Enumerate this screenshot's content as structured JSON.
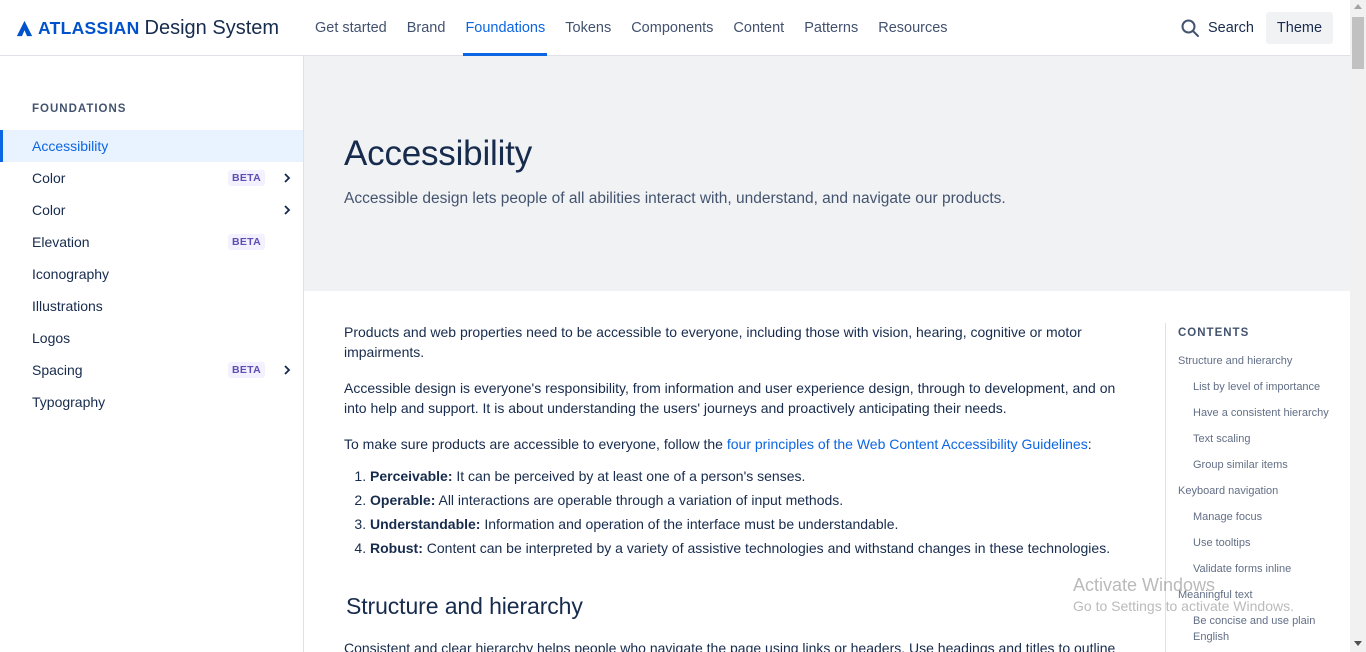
{
  "header": {
    "brand": "ATLASSIAN",
    "product": "Design System",
    "nav": [
      {
        "label": "Get started",
        "active": false
      },
      {
        "label": "Brand",
        "active": false
      },
      {
        "label": "Foundations",
        "active": true
      },
      {
        "label": "Tokens",
        "active": false
      },
      {
        "label": "Components",
        "active": false
      },
      {
        "label": "Content",
        "active": false
      },
      {
        "label": "Patterns",
        "active": false
      },
      {
        "label": "Resources",
        "active": false
      }
    ],
    "search_label": "Search",
    "theme_label": "Theme"
  },
  "sidebar": {
    "heading": "FOUNDATIONS",
    "items": [
      {
        "label": "Accessibility",
        "badge": "",
        "chevron": false,
        "active": true
      },
      {
        "label": "Color",
        "badge": "BETA",
        "chevron": true,
        "active": false
      },
      {
        "label": "Color",
        "badge": "",
        "chevron": true,
        "active": false
      },
      {
        "label": "Elevation",
        "badge": "BETA",
        "chevron": false,
        "active": false
      },
      {
        "label": "Iconography",
        "badge": "",
        "chevron": false,
        "active": false
      },
      {
        "label": "Illustrations",
        "badge": "",
        "chevron": false,
        "active": false
      },
      {
        "label": "Logos",
        "badge": "",
        "chevron": false,
        "active": false
      },
      {
        "label": "Spacing",
        "badge": "BETA",
        "chevron": true,
        "active": false
      },
      {
        "label": "Typography",
        "badge": "",
        "chevron": false,
        "active": false
      }
    ]
  },
  "hero": {
    "title": "Accessibility",
    "subtitle": "Accessible design lets people of all abilities interact with, understand, and navigate our products."
  },
  "content": {
    "p1": "Products and web properties need to be accessible to everyone, including those with vision, hearing, cognitive or motor impairments.",
    "p2": "Accessible design is everyone's responsibility, from information and user experience design, through to development, and on into help and support. It is about understanding the users' journeys and proactively anticipating their needs.",
    "p3_before": "To make sure products are accessible to everyone, follow the ",
    "p3_link": "four principles of the Web Content Accessibility Guidelines",
    "p3_after": ":",
    "principles": [
      {
        "term": "Perceivable:",
        "text": " It can be perceived by at least one of a person's senses."
      },
      {
        "term": "Operable:",
        "text": " All interactions are operable through a variation of input methods."
      },
      {
        "term": "Understandable:",
        "text": " Information and operation of the interface must be understandable."
      },
      {
        "term": "Robust:",
        "text": " Content can be interpreted by a variety of assistive technologies and withstand changes in these technologies."
      }
    ],
    "h2": "Structure and hierarchy",
    "p4": "Consistent and clear hierarchy helps people who navigate the page using links or headers. Use headings and titles to outline"
  },
  "toc": {
    "heading": "CONTENTS",
    "items": [
      {
        "label": "Structure and hierarchy",
        "level": 1
      },
      {
        "label": "List by level of importance",
        "level": 2
      },
      {
        "label": "Have a consistent hierarchy",
        "level": 2
      },
      {
        "label": "Text scaling",
        "level": 2
      },
      {
        "label": "Group similar items",
        "level": 2
      },
      {
        "label": "Keyboard navigation",
        "level": 1
      },
      {
        "label": "Manage focus",
        "level": 2
      },
      {
        "label": "Use tooltips",
        "level": 2
      },
      {
        "label": "Validate forms inline",
        "level": 2
      },
      {
        "label": "Meaningful text",
        "level": 1
      },
      {
        "label": "Be concise and use plain English",
        "level": 2
      }
    ]
  },
  "watermark": {
    "line1": "Activate Windows",
    "line2": "Go to Settings to activate Windows."
  },
  "colors": {
    "accent": "#0c66e4",
    "text": "#172b4d",
    "subtle": "#44546f",
    "hero_bg": "#f1f2f4",
    "beta_bg": "#f3f0ff",
    "beta_text": "#5e4db2"
  }
}
